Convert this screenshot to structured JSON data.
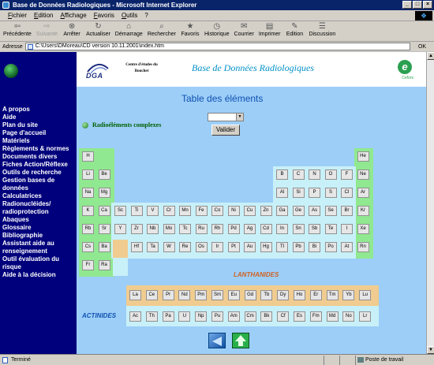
{
  "window": {
    "title": "Base de Données Radiologiques - Microsoft Internet Explorer",
    "controls": [
      "_",
      "□",
      "×"
    ]
  },
  "menu": [
    "Fichier",
    "Edition",
    "Affichage",
    "Favoris",
    "Outils",
    "?"
  ],
  "toolbar": [
    {
      "label": "Précédente",
      "icon": "back-arrow-icon",
      "disabled": false
    },
    {
      "label": "Suivante",
      "icon": "forward-arrow-icon",
      "disabled": true
    },
    {
      "label": "Arrêter",
      "icon": "stop-icon",
      "disabled": false
    },
    {
      "label": "Actualiser",
      "icon": "refresh-icon",
      "disabled": false
    },
    {
      "label": "Démarrage",
      "icon": "home-icon",
      "disabled": false
    },
    {
      "label": "Rechercher",
      "icon": "search-icon",
      "disabled": false
    },
    {
      "label": "Favoris",
      "icon": "favorites-icon",
      "disabled": false
    },
    {
      "label": "Historique",
      "icon": "history-icon",
      "disabled": false
    },
    {
      "label": "Courrier",
      "icon": "mail-icon",
      "disabled": false
    },
    {
      "label": "Imprimer",
      "icon": "print-icon",
      "disabled": false
    },
    {
      "label": "Edition",
      "icon": "edit-icon",
      "disabled": false
    },
    {
      "label": "Discussion",
      "icon": "discuss-icon",
      "disabled": false
    }
  ],
  "address": {
    "label": "Adresse",
    "value": "C:\\Users\\DMoreau\\CD version 10.11.2001\\index.htm",
    "go": "OK"
  },
  "banner": {
    "org": "DGA",
    "centre": "Centre d'études du Bouchet",
    "title": "Base de Données Radiologiques",
    "partner": "Cefors"
  },
  "sidebar": {
    "items": [
      "A propos",
      "Aide",
      "Plan du site",
      "Page d'accueil",
      "Matériels",
      "Règlements & normes",
      "Documents divers",
      "Fiches Action/Réflexe",
      "Outils de recherche",
      "Gestion bases de données",
      "Calculatrices",
      "Radionucléides/ radioprotection",
      "Abaques",
      "Glossaire",
      "Bibliographie",
      "Assistant aide au renseignement",
      "Outil évaluation du risque",
      "Aide à la décision"
    ]
  },
  "main": {
    "table_title": "Table des éléments",
    "radio_label": "Radioéléments complexes",
    "select_value": "",
    "valider": "Valider",
    "lanthanides_label": "LANTHANIDES",
    "actinides_label": "ACTINIDES",
    "colors": {
      "lanthanides_label": "#d06020",
      "actinides_label": "#1050b0",
      "green": "#90e890",
      "peach": "#f0cc90",
      "light": "#c8f0f8"
    }
  },
  "periodic_table": {
    "rows": [
      [
        "H",
        "",
        "",
        "",
        "",
        "",
        "",
        "",
        "",
        "",
        "",
        "",
        "",
        "",
        "",
        "",
        "",
        "He"
      ],
      [
        "Li",
        "Be",
        "",
        "",
        "",
        "",
        "",
        "",
        "",
        "",
        "",
        "",
        "B",
        "C",
        "N",
        "O",
        "F",
        "Ne"
      ],
      [
        "Na",
        "Mg",
        "",
        "",
        "",
        "",
        "",
        "",
        "",
        "",
        "",
        "",
        "Al",
        "Si",
        "P",
        "S",
        "Cl",
        "Ar"
      ],
      [
        "K",
        "Ca",
        "Sc",
        "Ti",
        "V",
        "Cr",
        "Mn",
        "Fe",
        "Co",
        "Ni",
        "Cu",
        "Zn",
        "Ga",
        "Ge",
        "As",
        "Se",
        "Br",
        "Kr"
      ],
      [
        "Rb",
        "Sr",
        "Y",
        "Zr",
        "Nb",
        "Mo",
        "Tc",
        "Ru",
        "Rh",
        "Pd",
        "Ag",
        "Cd",
        "In",
        "Sn",
        "Sb",
        "Te",
        "I",
        "Xe"
      ],
      [
        "Cs",
        "Ba",
        "",
        "Hf",
        "Ta",
        "W",
        "Re",
        "Os",
        "Ir",
        "Pt",
        "Au",
        "Hg",
        "Tl",
        "Pb",
        "Bi",
        "Po",
        "At",
        "Rn"
      ],
      [
        "Fr",
        "Ra",
        "",
        "",
        "",
        "",
        "",
        "",
        "",
        "",
        "",
        "",
        "",
        "",
        "",
        "",
        "",
        ""
      ]
    ],
    "lanthanides": [
      "La",
      "Ce",
      "Pr",
      "Nd",
      "Pm",
      "Sm",
      "Eu",
      "Gd",
      "Tb",
      "Dy",
      "Ho",
      "Er",
      "Tm",
      "Yb",
      "Lu"
    ],
    "actinides": [
      "Ac",
      "Th",
      "Pa",
      "U",
      "Np",
      "Pu",
      "Am",
      "Cm",
      "Bk",
      "Cf",
      "Es",
      "Fm",
      "Md",
      "No",
      "Lr"
    ]
  },
  "status": {
    "text": "Terminé",
    "zone": "Poste de travail"
  }
}
